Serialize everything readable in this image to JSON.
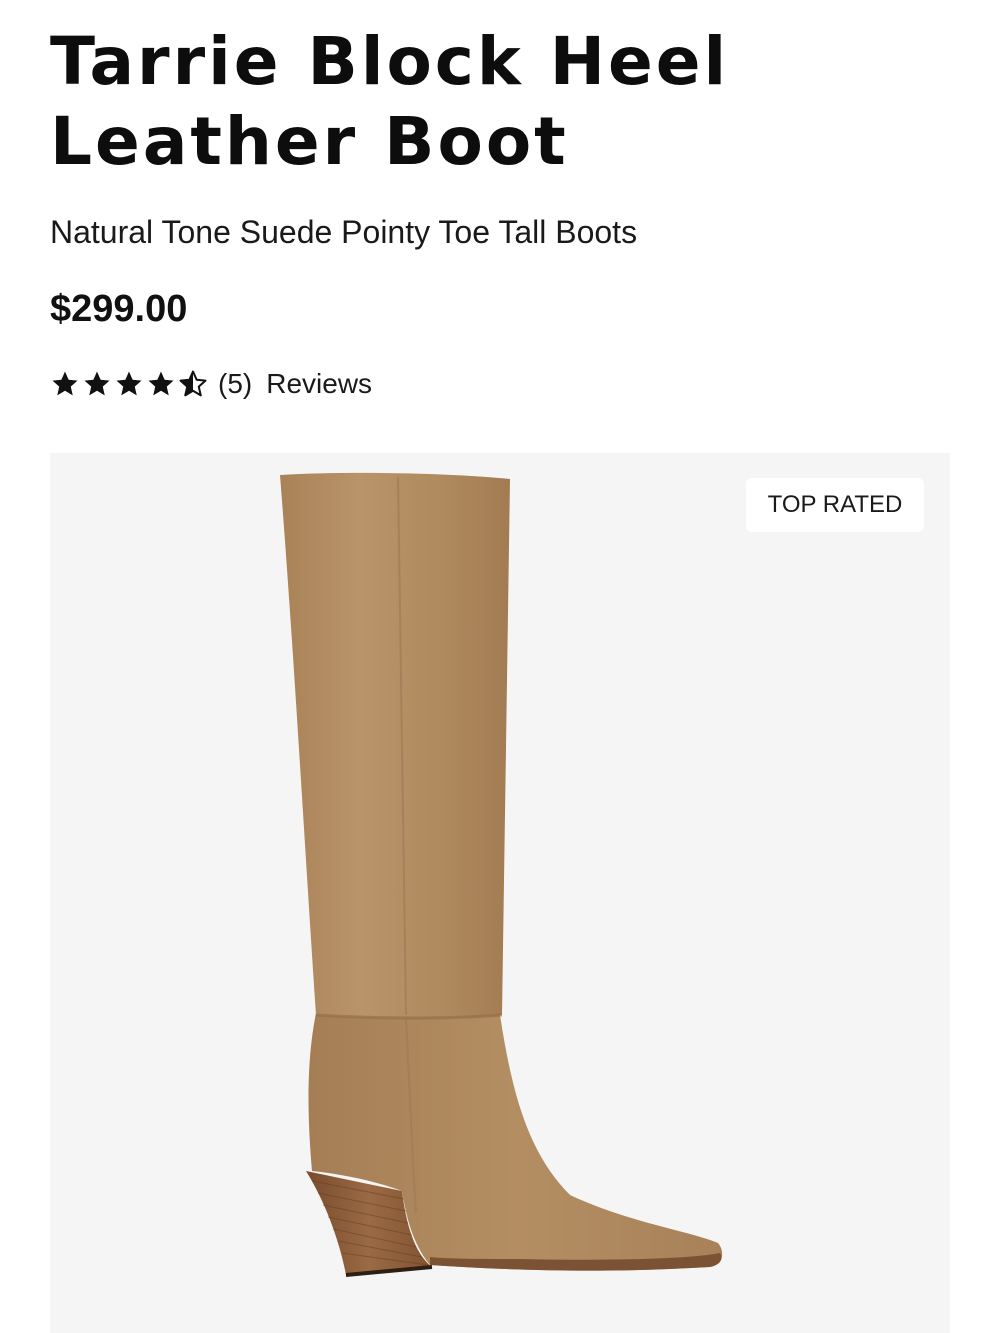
{
  "product": {
    "title": "Tarrie Block Heel Leather Boot",
    "subtitle": "Natural Tone Suede Pointy Toe Tall Boots",
    "price": "$299.00",
    "rating": {
      "value": 4.5,
      "max": 5,
      "count_label": "(5)",
      "reviews_label": "Reviews"
    },
    "badge": "TOP RATED",
    "image": {
      "subject": "tan suede knee-high boot with stacked wooden block heel"
    }
  },
  "colors": {
    "text": "#111111",
    "image_background": "#f6f5f5",
    "suede": "#b08a5f",
    "heel_wood": "#8a5a38"
  }
}
